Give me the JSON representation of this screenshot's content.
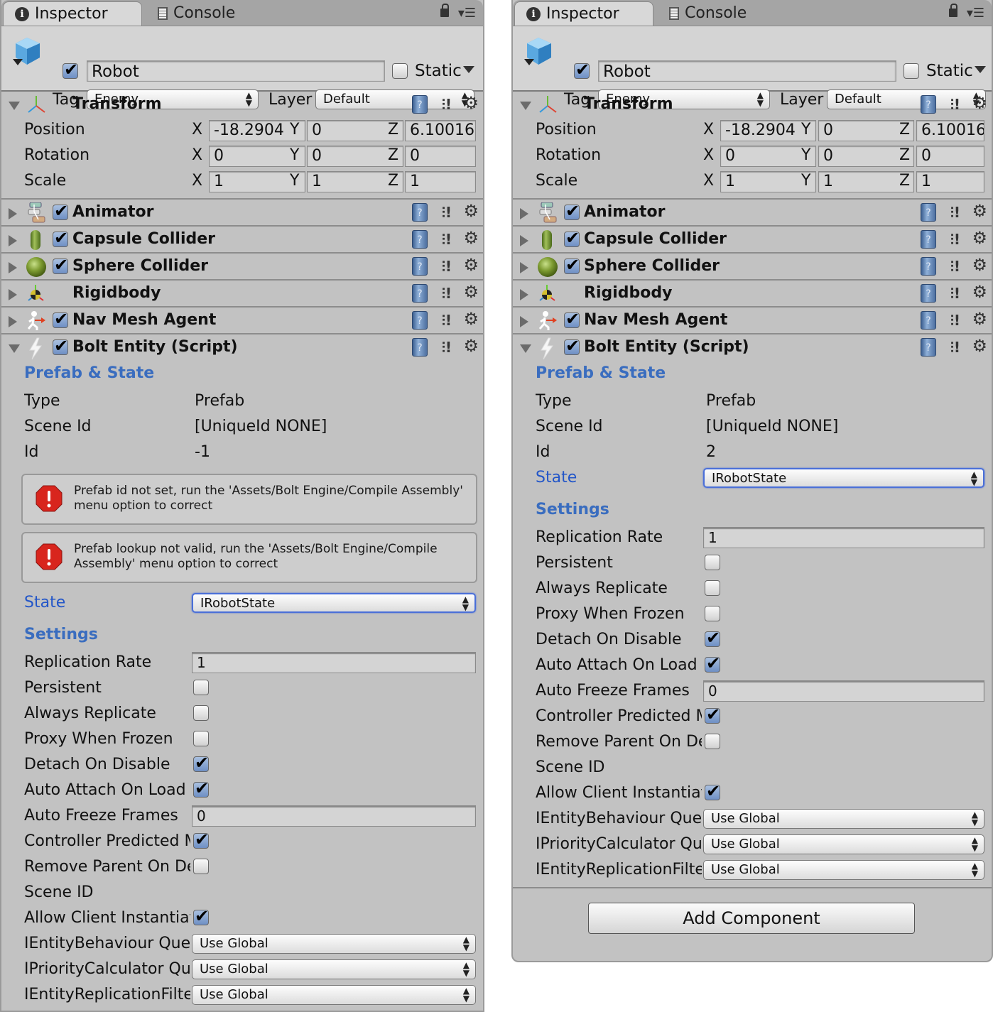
{
  "panels": [
    {
      "tabs": [
        {
          "label": "Inspector",
          "icon": "info-icon"
        },
        {
          "label": "Console",
          "icon": "console-icon"
        }
      ],
      "object": {
        "active": true,
        "name": "Robot",
        "static_label": "Static",
        "static": false,
        "tag_label": "Tag",
        "tag": "Enemy",
        "layer_label": "Layer",
        "layer": "Default"
      },
      "transform": {
        "name": "Transform",
        "rows": [
          {
            "label": "Position",
            "x": "-18.2904",
            "y": "0",
            "z": "6.10016"
          },
          {
            "label": "Rotation",
            "x": "0",
            "y": "0",
            "z": "0"
          },
          {
            "label": "Scale",
            "x": "1",
            "y": "1",
            "z": "1"
          }
        ]
      },
      "components": [
        {
          "name": "Animator",
          "icon": "animator-icon",
          "enabled": true,
          "has_toggle": true
        },
        {
          "name": "Capsule Collider",
          "icon": "capsule-collider-icon",
          "enabled": true,
          "has_toggle": true
        },
        {
          "name": "Sphere Collider",
          "icon": "sphere-collider-icon",
          "enabled": true,
          "has_toggle": true
        },
        {
          "name": "Rigidbody",
          "icon": "rigidbody-icon",
          "enabled": false,
          "has_toggle": false
        },
        {
          "name": "Nav Mesh Agent",
          "icon": "nav-mesh-agent-icon",
          "enabled": true,
          "has_toggle": true
        }
      ],
      "bolt": {
        "name": "Bolt Entity (Script)",
        "prefab_state_head": "Prefab & State",
        "type_label": "Type",
        "type": "Prefab",
        "scene_id_label": "Scene Id",
        "scene_id": "[UniqueId NONE]",
        "id_label": "Id",
        "id": "-1",
        "errors": [
          "Prefab id not set, run the 'Assets/Bolt Engine/Compile Assembly' menu option to correct",
          "Prefab lookup not valid, run the 'Assets/Bolt Engine/Compile Assembly' menu option to correct"
        ],
        "state_label": "State",
        "state": "IRobotState",
        "settings_head": "Settings",
        "replication_rate_label": "Replication Rate",
        "replication_rate": "1",
        "persistent_label": "Persistent",
        "persistent": false,
        "always_replicate_label": "Always Replicate",
        "always_replicate": false,
        "proxy_when_frozen_label": "Proxy When Frozen",
        "proxy_when_frozen": false,
        "detach_on_disable_label": "Detach On Disable",
        "detach_on_disable": true,
        "auto_attach_label": "Auto Attach On Load",
        "auto_attach": true,
        "auto_freeze_label": "Auto Freeze Frames",
        "auto_freeze": "0",
        "controller_predicted_label": "Controller Predicted M",
        "controller_predicted": true,
        "remove_parent_label": "Remove Parent On Det",
        "remove_parent": false,
        "scene_id2_label": "Scene ID",
        "allow_client_label": "Allow Client Instantiat",
        "allow_client": true,
        "queries": [
          {
            "label": "IEntityBehaviour Query",
            "value": "Use Global"
          },
          {
            "label": "IPriorityCalculator Que",
            "value": "Use Global"
          },
          {
            "label": "IEntityReplicationFilter",
            "value": "Use Global"
          }
        ]
      }
    },
    {
      "tabs": [
        {
          "label": "Inspector",
          "icon": "info-icon"
        },
        {
          "label": "Console",
          "icon": "console-icon"
        }
      ],
      "object": {
        "active": true,
        "name": "Robot",
        "static_label": "Static",
        "static": false,
        "tag_label": "Tag",
        "tag": "Enemy",
        "layer_label": "Layer",
        "layer": "Default"
      },
      "transform": {
        "name": "Transform",
        "rows": [
          {
            "label": "Position",
            "x": "-18.2904",
            "y": "0",
            "z": "6.10016"
          },
          {
            "label": "Rotation",
            "x": "0",
            "y": "0",
            "z": "0"
          },
          {
            "label": "Scale",
            "x": "1",
            "y": "1",
            "z": "1"
          }
        ]
      },
      "components": [
        {
          "name": "Animator",
          "icon": "animator-icon",
          "enabled": true,
          "has_toggle": true
        },
        {
          "name": "Capsule Collider",
          "icon": "capsule-collider-icon",
          "enabled": true,
          "has_toggle": true
        },
        {
          "name": "Sphere Collider",
          "icon": "sphere-collider-icon",
          "enabled": true,
          "has_toggle": true
        },
        {
          "name": "Rigidbody",
          "icon": "rigidbody-icon",
          "enabled": false,
          "has_toggle": false
        },
        {
          "name": "Nav Mesh Agent",
          "icon": "nav-mesh-agent-icon",
          "enabled": true,
          "has_toggle": true
        }
      ],
      "bolt": {
        "name": "Bolt Entity (Script)",
        "prefab_state_head": "Prefab & State",
        "type_label": "Type",
        "type": "Prefab",
        "scene_id_label": "Scene Id",
        "scene_id": "[UniqueId NONE]",
        "id_label": "Id",
        "id": "2",
        "errors": [],
        "state_label": "State",
        "state": "IRobotState",
        "settings_head": "Settings",
        "replication_rate_label": "Replication Rate",
        "replication_rate": "1",
        "persistent_label": "Persistent",
        "persistent": false,
        "always_replicate_label": "Always Replicate",
        "always_replicate": false,
        "proxy_when_frozen_label": "Proxy When Frozen",
        "proxy_when_frozen": false,
        "detach_on_disable_label": "Detach On Disable",
        "detach_on_disable": true,
        "auto_attach_label": "Auto Attach On Load",
        "auto_attach": true,
        "auto_freeze_label": "Auto Freeze Frames",
        "auto_freeze": "0",
        "controller_predicted_label": "Controller Predicted M",
        "controller_predicted": true,
        "remove_parent_label": "Remove Parent On Det",
        "remove_parent": false,
        "scene_id2_label": "Scene ID",
        "allow_client_label": "Allow Client Instantiat",
        "allow_client": true,
        "queries": [
          {
            "label": "IEntityBehaviour Query",
            "value": "Use Global"
          },
          {
            "label": "IPriorityCalculator Que",
            "value": "Use Global"
          },
          {
            "label": "IEntityReplicationFilter",
            "value": "Use Global"
          }
        ]
      },
      "add_component_label": "Add Component"
    }
  ],
  "colors": {
    "panel_bg": "#c2c2c2",
    "header_bg": "#d4d4d4",
    "section_blue": "#3a6dbf",
    "state_blue": "#2356c8",
    "focus_ring": "#4a6fd8",
    "error_red": "#d8251d"
  }
}
